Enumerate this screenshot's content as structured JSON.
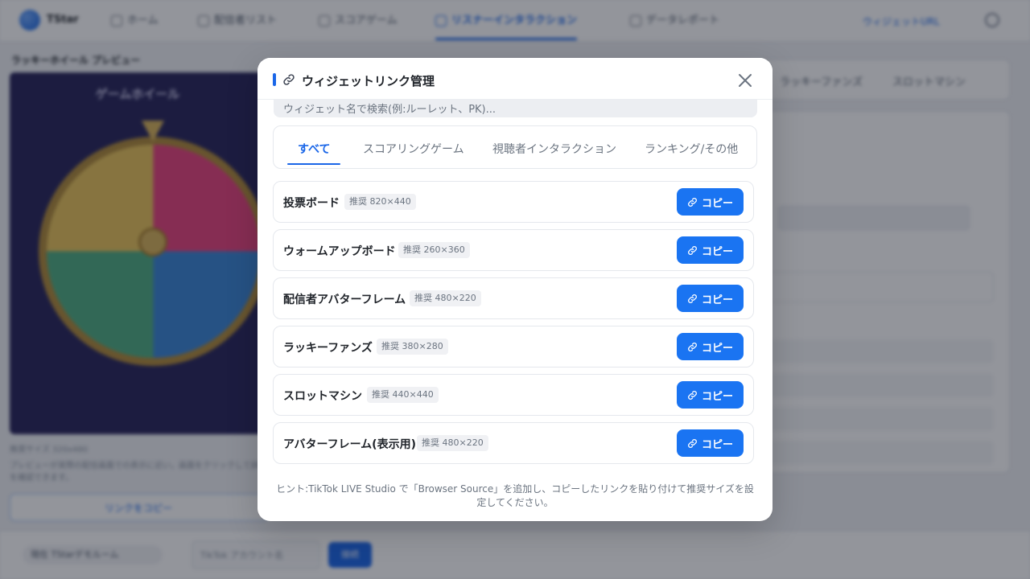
{
  "app": {
    "logo_text": "TStar",
    "nav": [
      {
        "label": "ホーム"
      },
      {
        "label": "配信者リスト"
      },
      {
        "label": "スコアゲーム"
      },
      {
        "label": "リスナーインタラクション"
      },
      {
        "label": "データレポート"
      }
    ],
    "nav_link": "ウィジェットURL",
    "left_title": "ラッキーホイール プレビュー",
    "preview_title": "ゲームホイール",
    "preview_meta": "推奨サイズ 320x480",
    "preview_desc": "プレビューが実際の配信画面での表示に近い。画面をクリックして詳細を確認できます。",
    "copy_link_label": "リンクをコピー",
    "right_tabs": [
      "ラッキーファンズ",
      "スロットマシン"
    ],
    "bottom": {
      "room": "現在 TStarデモルーム",
      "input_placeholder": "TikTok アカウント名",
      "button": "接続"
    }
  },
  "modal": {
    "title": "ウィジェットリンク管理",
    "search_placeholder": "ウィジェット名で検索(例:ルーレット、PK)...",
    "tabs": [
      {
        "label": "すべて",
        "active": true
      },
      {
        "label": "スコアリングゲーム",
        "active": false
      },
      {
        "label": "視聴者インタラクション",
        "active": false
      },
      {
        "label": "ランキング/その他",
        "active": false
      }
    ],
    "copy_label": "コピー",
    "widgets": [
      {
        "name": "投票ボード",
        "size": "推奨 820×440"
      },
      {
        "name": "ウォームアップボード",
        "size": "推奨 260×360"
      },
      {
        "name": "配信者アバターフレーム",
        "size": "推奨 480×220"
      },
      {
        "name": "ラッキーファンズ",
        "size": "推奨 380×280"
      },
      {
        "name": "スロットマシン",
        "size": "推奨 440×440"
      },
      {
        "name": "アバターフレーム(表示用)",
        "size": "推奨 480×220"
      }
    ],
    "hint": "ヒント:TikTok LIVE Studio で「Browser Source」を追加し、コピーしたリンクを貼り付けて推奨サイズを設定してください。"
  },
  "colors": {
    "accent": "#1a66e8",
    "copy_button": "#1a74f2",
    "overlay": "rgba(16,20,34,0.45)"
  },
  "icons": {
    "title": "link-icon",
    "close": "close-icon",
    "copy": "link-icon"
  }
}
